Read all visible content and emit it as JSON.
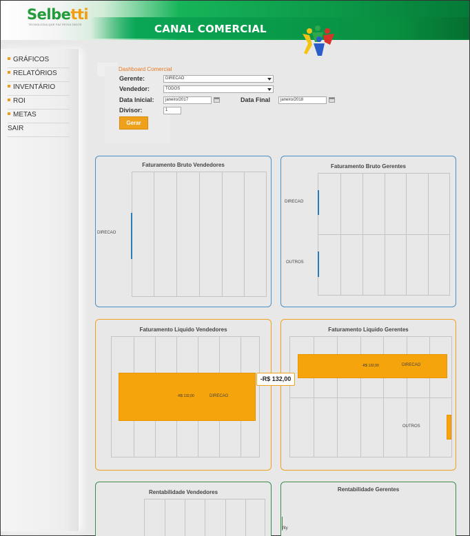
{
  "header": {
    "logo_main": "Selbe",
    "logo_accent": "tti",
    "logo_tagline": "TECNOLOGIA QUE FAZ RESULTADOS",
    "app_title": "CANAL COMERCIAL"
  },
  "sidebar": {
    "items": [
      {
        "label": "GRÁFICOS",
        "bullet": true
      },
      {
        "label": "RELATÓRIOS",
        "bullet": true
      },
      {
        "label": "INVENTÁRIO",
        "bullet": true
      },
      {
        "label": "ROI",
        "bullet": true
      },
      {
        "label": "METAS",
        "bullet": true
      },
      {
        "label": "SAIR",
        "bullet": false
      }
    ]
  },
  "filters": {
    "title": "Dashboard Comercial",
    "gerente_label": "Gerente:",
    "gerente_value": "DIRECAO",
    "vendedor_label": "Vendedor:",
    "vendedor_value": "TODOS",
    "data_inicial_label": "Data Inicial:",
    "data_inicial_value": "janeiro/2017",
    "data_final_label": "Data Final",
    "data_final_value": "janeiro/2018",
    "divisor_label": "Divisor:",
    "divisor_value": "1",
    "gerar_label": "Gerar"
  },
  "colors": {
    "accent_orange": "#f0a11b",
    "brand_green": "#0aa656",
    "panel_blue": "#4a90c8",
    "panel_green": "#3c8a4a",
    "bar_blue": "#2a7ab8"
  },
  "chart_data": [
    {
      "type": "bar",
      "title": "Faturamento Bruto Vendedores",
      "categories": [
        "DIRECAO"
      ],
      "values": [
        0
      ]
    },
    {
      "type": "bar",
      "title": "Faturamento Bruto Gerentes",
      "categories": [
        "DIRECAO",
        "OUTROS"
      ],
      "values": [
        0,
        0
      ]
    },
    {
      "type": "bar",
      "title": "Faturamento Liquido Vendedores",
      "categories": [
        "DIRECAO"
      ],
      "value_labels": [
        "-R$ 132,00"
      ],
      "values": [
        -132
      ],
      "tooltip": "-R$ 132,00"
    },
    {
      "type": "bar",
      "title": "Faturamento Liquido Gerentes",
      "categories": [
        "DIRECAO",
        "OUTROS"
      ],
      "value_labels": [
        "-R$ 132,00"
      ],
      "values": [
        -132,
        -5
      ]
    },
    {
      "type": "bar",
      "title": "Rentabilidade Vendedores",
      "categories": [],
      "values": []
    },
    {
      "type": "bar",
      "title": "Rentabilidade Gerentes",
      "categories": [
        "fity"
      ],
      "values": []
    }
  ]
}
